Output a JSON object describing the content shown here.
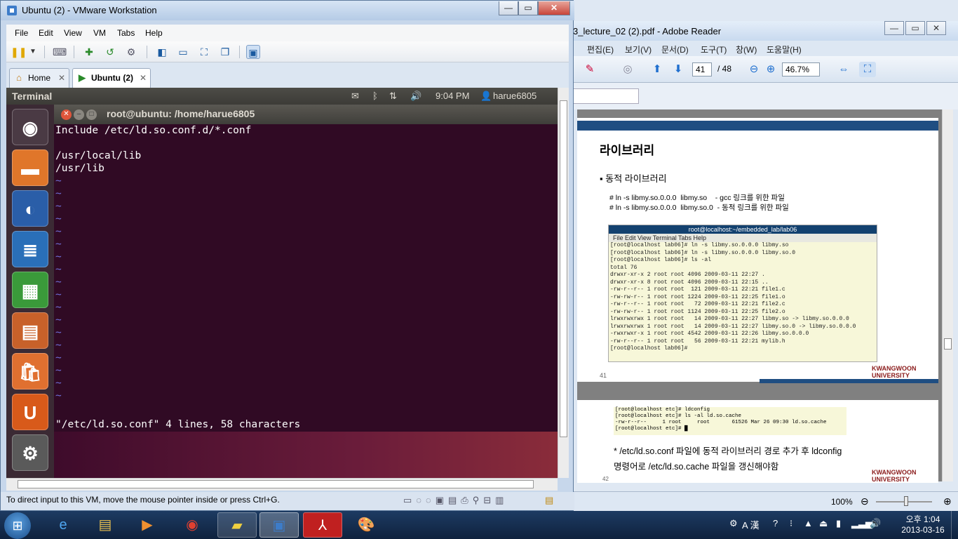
{
  "vmware": {
    "title": "Ubuntu (2) - VMware Workstation",
    "menu": [
      "File",
      "Edit",
      "View",
      "VM",
      "Tabs",
      "Help"
    ],
    "tabs": [
      {
        "label": "Home"
      },
      {
        "label": "Ubuntu (2)"
      }
    ],
    "status_message": "To direct input to this VM, move the mouse pointer inside or press Ctrl+G."
  },
  "ubuntu": {
    "panel_title": "Terminal",
    "time": "9:04 PM",
    "user": "harue6805",
    "terminal": {
      "title": "root@ubuntu: /home/harue6805",
      "lines": [
        "Include /etc/ld.so.conf.d/*.conf",
        "",
        "/usr/local/lib",
        "/usr/lib"
      ],
      "tilde": "~",
      "status_line": "\"/etc/ld.so.conf\" 4 lines, 58 characters"
    }
  },
  "pdf": {
    "title": "3_lecture_02 (2).pdf - Adobe Reader",
    "menu": [
      "편집(E)",
      "보기(V)",
      "문서(D)",
      "도구(T)",
      "창(W)",
      "도움말(H)"
    ],
    "page_current": "41",
    "page_total": "/ 48",
    "zoom": "46.7%",
    "slide": {
      "heading": "라이브러리",
      "bullet": "동적 라이브러리",
      "cmd1": "# ln -s libmy.so.0.0.0  libmy.so    - gcc 링크를 위한 파일",
      "cmd2": "# ln -s libmy.so.0.0.0  libmy.so.0  - 동적 링크를 위한 파일",
      "page_no": "41",
      "logo": "KWANGWOON UNIVERSITY",
      "term_title": "root@localhost:~/embedded_lab/lab06",
      "term_menu": "File  Edit  View  Terminal  Tabs  Help",
      "term_lines": [
        "[root@localhost lab06]# ln -s libmy.so.0.0.0 libmy.so",
        "[root@localhost lab06]# ln -s libmy.so.0.0.0 libmy.so.0",
        "[root@localhost lab06]# ls -al",
        "total 76",
        "drwxr-xr-x 2 root root 4096 2009-03-11 22:27 .",
        "drwxr-xr-x 8 root root 4096 2009-03-11 22:15 ..",
        "-rw-r--r-- 1 root root  121 2009-03-11 22:21 file1.c",
        "-rw-rw-r-- 1 root root 1224 2009-03-11 22:25 file1.o",
        "-rw-r--r-- 1 root root   72 2009-03-11 22:21 file2.c",
        "-rw-rw-r-- 1 root root 1124 2009-03-11 22:25 file2.o",
        "lrwxrwxrwx 1 root root   14 2009-03-11 22:27 libmy.so -> libmy.so.0.0.0",
        "lrwxrwxrwx 1 root root   14 2009-03-11 22:27 libmy.so.0 -> libmy.so.0.0.0",
        "-rwxrwxr-x 1 root root 4542 2009-03-11 22:26 libmy.so.0.0.0",
        "-rw-r--r-- 1 root root   56 2009-03-11 22:21 mylib.h",
        "[root@localhost lab06]#"
      ]
    },
    "slide2": {
      "term_lines": [
        "[root@localhost etc]# ldconfig",
        "[root@localhost etc]# ls -al ld.so.cache",
        "-rw-r--r--     1 root     root       61526 Mar 26 09:30 ld.so.cache",
        "[root@localhost etc]# █"
      ],
      "note1": "* /etc/ld.so.conf 파일에 동적 라이브러리 경로 추가 후 ldconfig",
      "note2": "명령어로 /etc/ld.so.cache 파일을 갱신해야함",
      "page_no": "42",
      "logo": "KWANGWOON UNIVERSITY"
    },
    "status_zoom": "100%"
  },
  "taskbar": {
    "clock_time": "오후 1:04",
    "clock_date": "2013-03-16",
    "ime": "A 漢"
  }
}
